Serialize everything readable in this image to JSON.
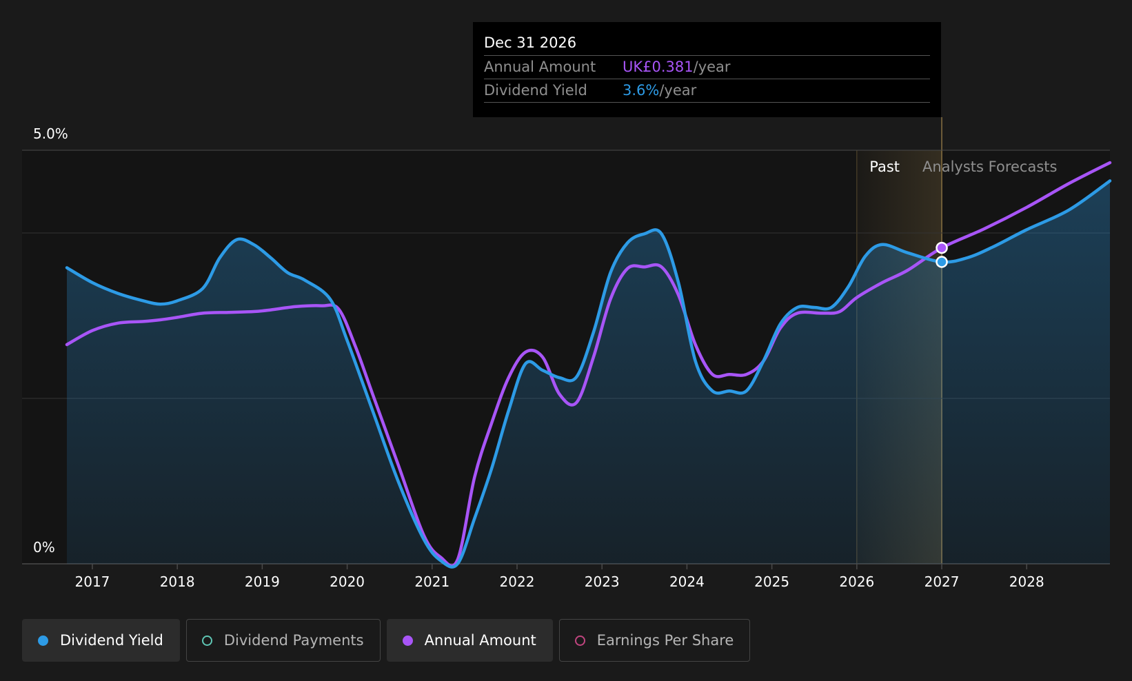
{
  "tooltip": {
    "date": "Dec 31 2026",
    "rows": [
      {
        "label": "Annual Amount",
        "value": "UK£0.381",
        "unit": "/year"
      },
      {
        "label": "Dividend Yield",
        "value": "3.6%",
        "unit": "/year"
      }
    ]
  },
  "legend": [
    {
      "label": "Dividend Yield",
      "color": "#2d9be6",
      "active": true
    },
    {
      "label": "Dividend Payments",
      "color": "#5fc6b4",
      "active": false
    },
    {
      "label": "Annual Amount",
      "color": "#a855f7",
      "active": true
    },
    {
      "label": "Earnings Per Share",
      "color": "#c0457f",
      "active": false
    }
  ],
  "chart_data": {
    "type": "line",
    "y_axis": {
      "ticks": [
        "5.0%",
        "0%"
      ],
      "range": [
        0,
        5.0
      ],
      "unit": "%"
    },
    "x_axis": {
      "ticks": [
        "2017",
        "2018",
        "2019",
        "2020",
        "2021",
        "2022",
        "2023",
        "2024",
        "2025",
        "2026",
        "2027",
        "2028"
      ],
      "range": [
        2016.7,
        2028.98
      ]
    },
    "regions": {
      "past": "Past",
      "forecast": "Analysts Forecasts",
      "past_start": 2026.0,
      "current": 2027.0
    },
    "grid": true,
    "series": [
      {
        "name": "Dividend Yield",
        "color": "#2d9be6",
        "filled": true,
        "points": [
          [
            2016.7,
            3.58
          ],
          [
            2017.0,
            3.4
          ],
          [
            2017.3,
            3.27
          ],
          [
            2017.6,
            3.18
          ],
          [
            2017.8,
            3.14
          ],
          [
            2018.0,
            3.18
          ],
          [
            2018.3,
            3.33
          ],
          [
            2018.5,
            3.7
          ],
          [
            2018.7,
            3.92
          ],
          [
            2018.9,
            3.86
          ],
          [
            2019.1,
            3.7
          ],
          [
            2019.3,
            3.52
          ],
          [
            2019.5,
            3.43
          ],
          [
            2019.8,
            3.2
          ],
          [
            2020.0,
            2.7
          ],
          [
            2020.3,
            1.85
          ],
          [
            2020.6,
            1.0
          ],
          [
            2020.9,
            0.3
          ],
          [
            2021.1,
            0.04
          ],
          [
            2021.3,
            0.0
          ],
          [
            2021.5,
            0.55
          ],
          [
            2021.7,
            1.15
          ],
          [
            2021.9,
            1.85
          ],
          [
            2022.1,
            2.42
          ],
          [
            2022.3,
            2.34
          ],
          [
            2022.5,
            2.25
          ],
          [
            2022.7,
            2.26
          ],
          [
            2022.9,
            2.8
          ],
          [
            2023.1,
            3.52
          ],
          [
            2023.3,
            3.88
          ],
          [
            2023.5,
            3.99
          ],
          [
            2023.7,
            3.99
          ],
          [
            2023.9,
            3.4
          ],
          [
            2024.1,
            2.45
          ],
          [
            2024.3,
            2.09
          ],
          [
            2024.5,
            2.09
          ],
          [
            2024.7,
            2.09
          ],
          [
            2024.9,
            2.45
          ],
          [
            2025.1,
            2.9
          ],
          [
            2025.3,
            3.1
          ],
          [
            2025.5,
            3.1
          ],
          [
            2025.7,
            3.1
          ],
          [
            2025.9,
            3.35
          ],
          [
            2026.1,
            3.72
          ],
          [
            2026.3,
            3.86
          ],
          [
            2026.6,
            3.76
          ],
          [
            2027.0,
            3.65
          ],
          [
            2027.3,
            3.7
          ],
          [
            2027.6,
            3.83
          ],
          [
            2028.0,
            4.04
          ],
          [
            2028.5,
            4.28
          ],
          [
            2028.98,
            4.63
          ]
        ]
      },
      {
        "name": "Annual Amount",
        "color": "#a855f7",
        "filled": false,
        "points": [
          [
            2016.7,
            2.65
          ],
          [
            2017.0,
            2.82
          ],
          [
            2017.3,
            2.91
          ],
          [
            2017.6,
            2.93
          ],
          [
            2017.8,
            2.95
          ],
          [
            2018.0,
            2.98
          ],
          [
            2018.3,
            3.03
          ],
          [
            2018.6,
            3.04
          ],
          [
            2018.9,
            3.05
          ],
          [
            2019.1,
            3.07
          ],
          [
            2019.4,
            3.11
          ],
          [
            2019.7,
            3.12
          ],
          [
            2019.9,
            3.08
          ],
          [
            2020.1,
            2.62
          ],
          [
            2020.3,
            2.05
          ],
          [
            2020.6,
            1.2
          ],
          [
            2020.9,
            0.35
          ],
          [
            2021.1,
            0.08
          ],
          [
            2021.3,
            0.05
          ],
          [
            2021.5,
            1.05
          ],
          [
            2021.7,
            1.7
          ],
          [
            2021.9,
            2.25
          ],
          [
            2022.1,
            2.56
          ],
          [
            2022.3,
            2.5
          ],
          [
            2022.5,
            2.05
          ],
          [
            2022.7,
            1.95
          ],
          [
            2022.9,
            2.5
          ],
          [
            2023.1,
            3.2
          ],
          [
            2023.3,
            3.57
          ],
          [
            2023.5,
            3.59
          ],
          [
            2023.7,
            3.59
          ],
          [
            2023.9,
            3.25
          ],
          [
            2024.1,
            2.65
          ],
          [
            2024.3,
            2.29
          ],
          [
            2024.5,
            2.29
          ],
          [
            2024.7,
            2.29
          ],
          [
            2024.9,
            2.45
          ],
          [
            2025.1,
            2.85
          ],
          [
            2025.3,
            3.03
          ],
          [
            2025.6,
            3.03
          ],
          [
            2025.8,
            3.05
          ],
          [
            2026.0,
            3.22
          ],
          [
            2026.3,
            3.4
          ],
          [
            2026.6,
            3.55
          ],
          [
            2027.0,
            3.82
          ],
          [
            2027.5,
            4.05
          ],
          [
            2028.0,
            4.31
          ],
          [
            2028.5,
            4.6
          ],
          [
            2028.98,
            4.85
          ]
        ]
      }
    ],
    "highlight_points": [
      {
        "series": "Annual Amount",
        "x": 2027.0,
        "y": 3.82
      },
      {
        "series": "Dividend Yield",
        "x": 2027.0,
        "y": 3.65
      }
    ]
  }
}
